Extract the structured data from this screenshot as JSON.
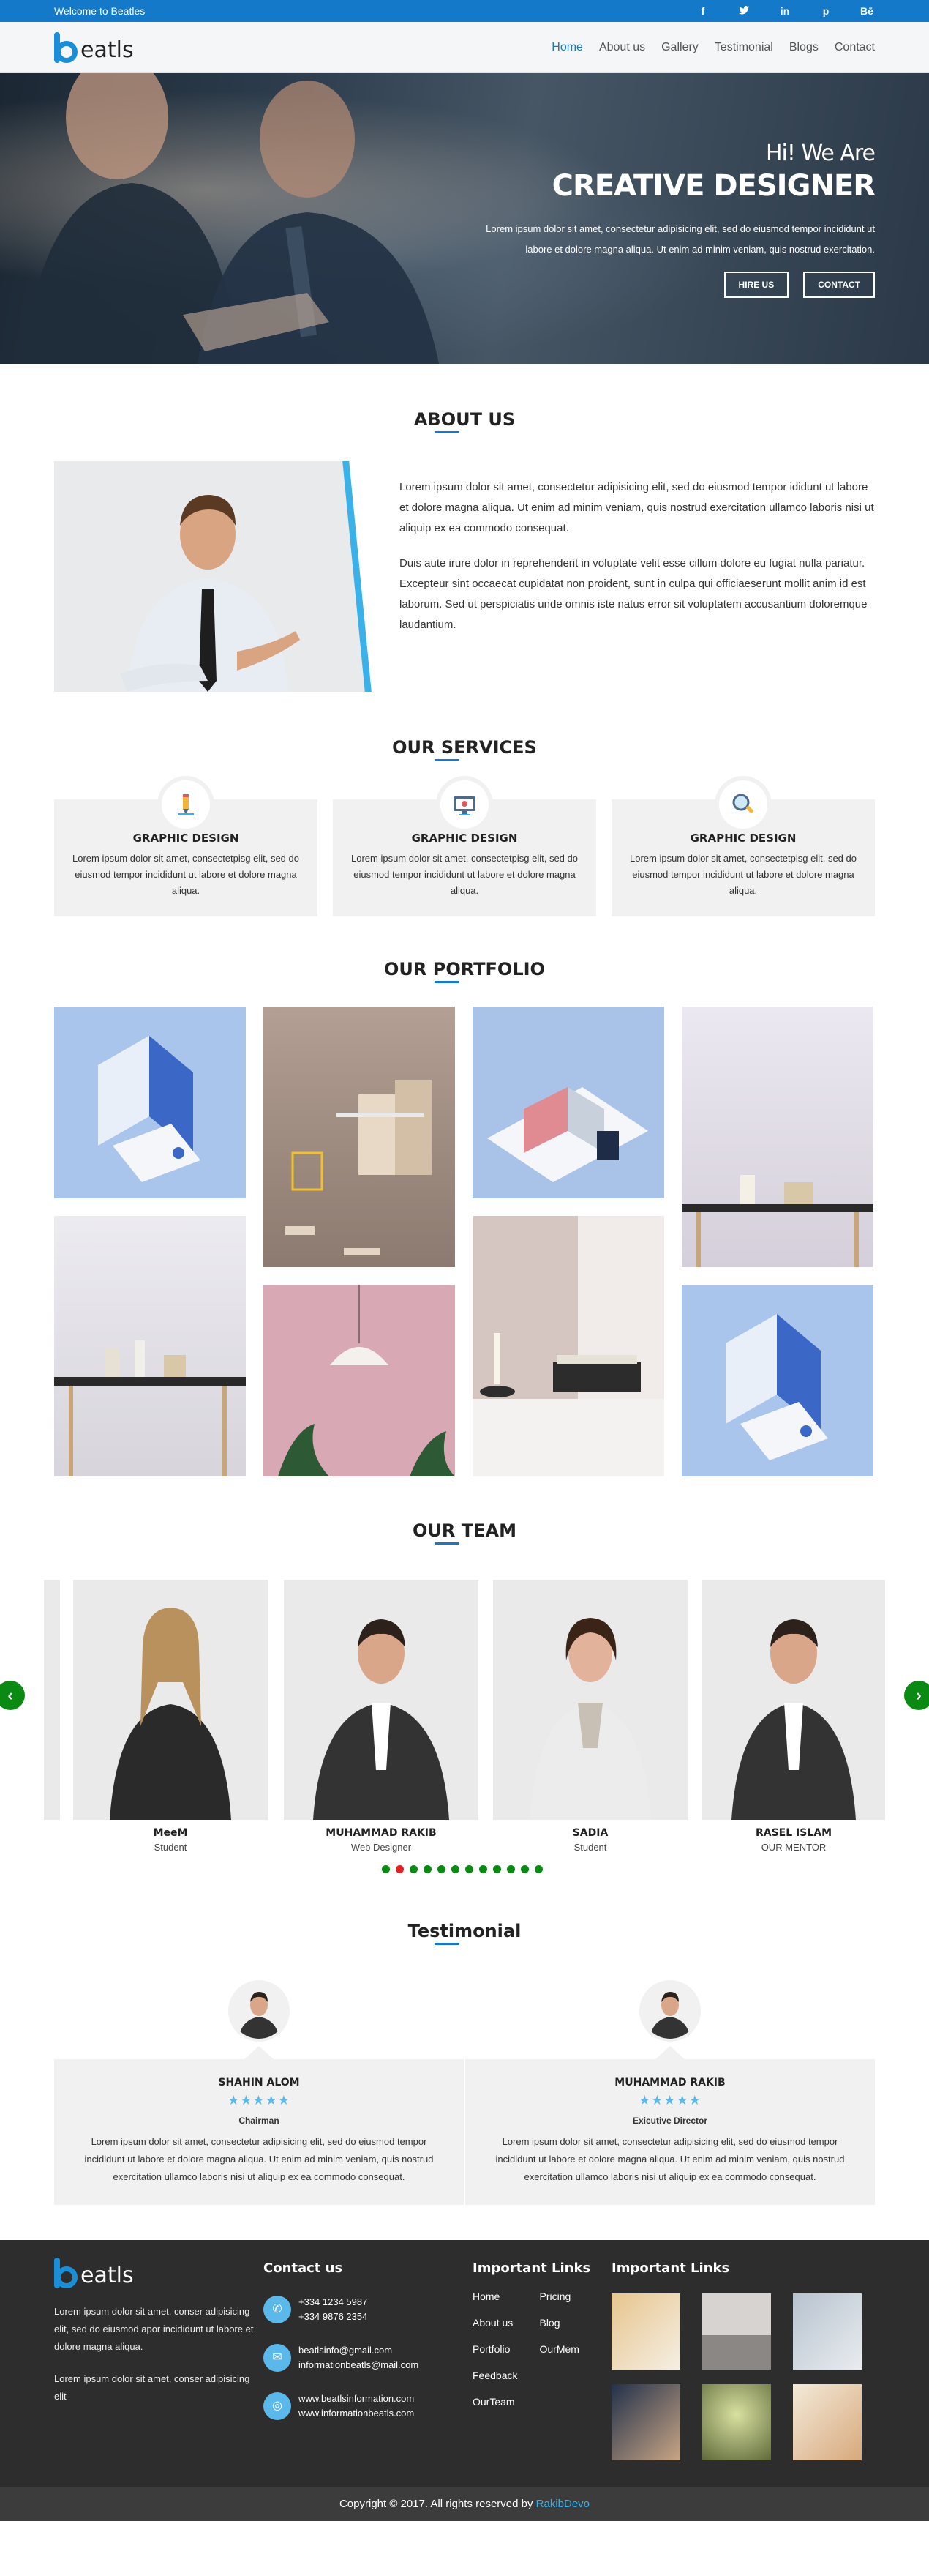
{
  "topbar": {
    "welcome": "Welcome to Beatles",
    "social": [
      {
        "icon": "facebook-icon",
        "glyph": "f"
      },
      {
        "icon": "twitter-icon",
        "glyph": "t"
      },
      {
        "icon": "linkedin-icon",
        "glyph": "in"
      },
      {
        "icon": "pinterest-icon",
        "glyph": "p"
      },
      {
        "icon": "behance-icon",
        "glyph": "Bē"
      }
    ]
  },
  "nav": {
    "logo": "eatls",
    "items": [
      "Home",
      "About us",
      "Gallery",
      "Testimonial",
      "Blogs",
      "Contact"
    ]
  },
  "hero": {
    "kicker": "Hi! We Are",
    "title": "CREATIVE DESIGNER",
    "text": "Lorem ipsum dolor sit amet, consectetur adipisicing elit, sed do eiusmod tempor incididunt ut labore et dolore magna aliqua. Ut enim ad minim veniam, quis nostrud exercitation.",
    "btn1": "HIRE US",
    "btn2": "CONTACT"
  },
  "about": {
    "title": "ABOUT US",
    "p1": "Lorem ipsum dolor sit amet, consectetur adipisicing elit, sed do eiusmod tempor ididunt ut labore et dolore magna aliqua. Ut enim ad minim veniam, quis nostrud exercitation ullamco laboris nisi ut aliquip ex ea commodo consequat.",
    "p2": "Duis aute irure dolor in reprehenderit in voluptate velit esse cillum dolore eu fugiat nulla pariatur. Excepteur sint occaecat cupidatat non proident, sunt in culpa qui officiaeserunt mollit anim id est laborum. Sed ut perspiciatis unde omnis iste natus error sit voluptatem accusantium doloremque laudantium."
  },
  "services": {
    "title": "OUR SERVICES",
    "items": [
      {
        "title": "GRAPHIC DESIGN",
        "text": "Lorem ipsum dolor sit amet, consectetpisg elit, sed do eiusmod tempor incididunt ut labore et dolore magna aliqua.",
        "icon": "pencil-icon"
      },
      {
        "title": "GRAPHIC DESIGN",
        "text": "Lorem ipsum dolor sit amet, consectetpisg elit, sed do eiusmod tempor incididunt ut labore et dolore magna aliqua.",
        "icon": "monitor-icon"
      },
      {
        "title": "GRAPHIC DESIGN",
        "text": "Lorem ipsum dolor sit amet, consectetpisg elit, sed do eiusmod tempor incididunt ut labore et dolore magna aliqua.",
        "icon": "magnifier-icon"
      }
    ]
  },
  "portfolio": {
    "title": "OUR PORTFOLIO"
  },
  "team": {
    "title": "OUR TEAM",
    "members": [
      {
        "name": "MeeM",
        "role": "Student"
      },
      {
        "name": "MUHAMMAD RAKIB",
        "role": "Web Designer"
      },
      {
        "name": "SADIA",
        "role": "Student"
      },
      {
        "name": "RASEL ISLAM",
        "role": "OUR MENTOR"
      }
    ],
    "prev": "‹",
    "next": "›"
  },
  "testimonial": {
    "title": "Testimonial",
    "items": [
      {
        "name": "SHAHIN ALOM",
        "role": "Chairman",
        "stars": "★★★★★",
        "text": "Lorem ipsum dolor sit amet, consectetur adipisicing elit, sed do eiusmod tempor incididunt ut labore et dolore magna aliqua. Ut enim ad minim veniam, quis nostrud exercitation ullamco laboris nisi ut aliquip ex ea commodo consequat."
      },
      {
        "name": "MUHAMMAD RAKIB",
        "role": "Exicutive Director",
        "stars": "★★★★★",
        "text": "Lorem ipsum dolor sit amet, consectetur adipisicing elit, sed do eiusmod tempor incididunt ut labore et dolore magna aliqua. Ut enim ad minim veniam, quis nostrud exercitation ullamco laboris nisi ut aliquip ex ea commodo consequat."
      }
    ]
  },
  "footer": {
    "logo": "eatls",
    "about1": "Lorem ipsum dolor sit amet, conser adipisicing elit, sed do eiusmod apor incididunt ut labore et dolore magna aliqua.",
    "about2": "Lorem ipsum dolor sit amet, conser adipisicing elit",
    "contact_title": "Contact us",
    "phone1": "+334 1234 5987",
    "phone2": "+334 9876 2354",
    "email1": "beatlsinfo@gmail.com",
    "email2": "informationbeatls@mail.com",
    "web1": "www.beatlsinformation.com",
    "web2": "www.informationbeatls.com",
    "links_title": "Important Links",
    "links_a": [
      "Home",
      "About us",
      "Portfolio",
      "Feedback",
      "OurTeam"
    ],
    "links_b": [
      "Pricing",
      "Blog",
      "OurMem"
    ],
    "gallery_title": "Important Links"
  },
  "copyright": {
    "text": "Copyright © 2017. All rights reserved by",
    "brand": "RakibDevo"
  },
  "colors": {
    "accent": "#1479c8",
    "light_blue": "#3ab1e8",
    "green": "#0a8a12",
    "dark": "#2d2d2d"
  }
}
